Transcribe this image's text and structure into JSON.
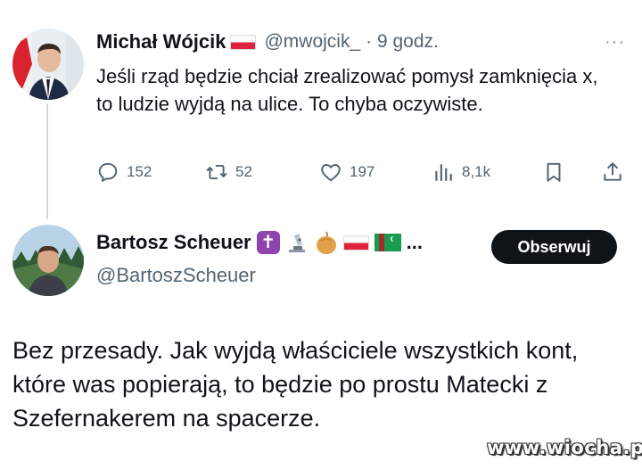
{
  "tweet1": {
    "author_name": "Michał Wójcik",
    "author_flag": "poland-flag",
    "handle": "@mwojcik_",
    "time": "· 9 godz.",
    "more_label": "···",
    "text": "Jeśli rząd będzie chciał zrealizować pomysł zamknięcia x, to ludzie wyjdą na ulice. To chyba oczywiste.",
    "actions": {
      "reply_count": "152",
      "retweet_count": "52",
      "like_count": "197",
      "views_count": "8,1k"
    }
  },
  "tweet2": {
    "author_name": "Bartosz Scheuer",
    "name_badges": [
      "cross-icon",
      "microscope-icon",
      "onion-icon",
      "poland-flag",
      "turkmenistan-flag"
    ],
    "badges_overflow": "...",
    "handle": "@BartoszScheuer",
    "follow_label": "Obserwuj",
    "text": "Bez przesady. Jak wyjdą właściciele wszystkich kont, które was popierają, to  będzie po prostu Matecki z Szefernakerem na spacerze."
  },
  "watermark": "www.wiocha.pl",
  "colors": {
    "text": "#0f1419",
    "secondary": "#536471",
    "button_bg": "#0f1419",
    "thread_line": "#cfd9de"
  }
}
